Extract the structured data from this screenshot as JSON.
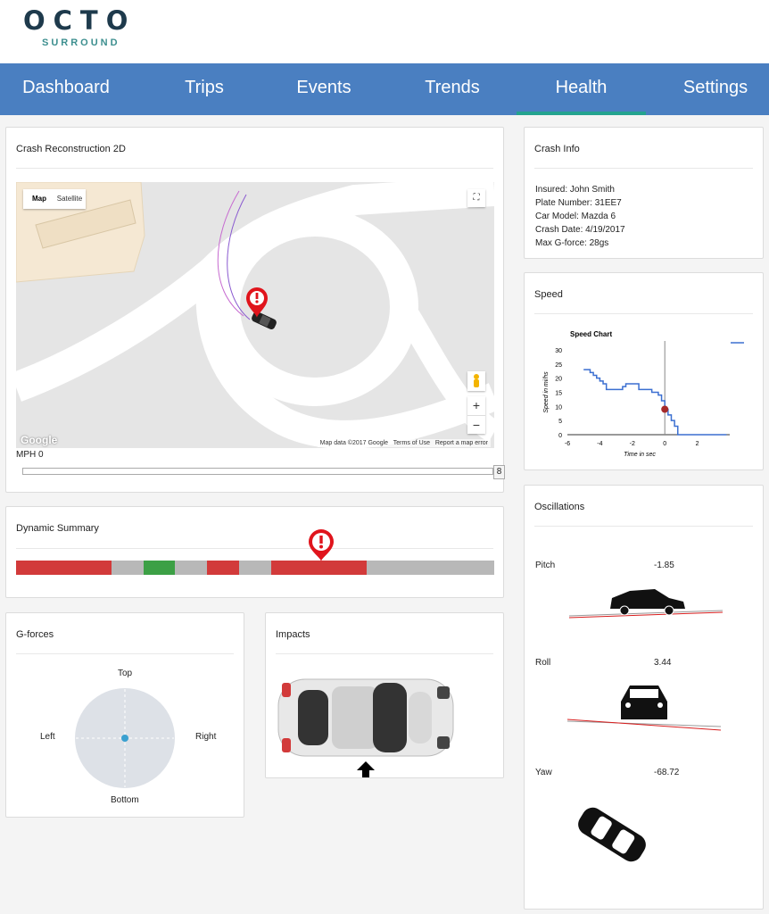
{
  "brand": {
    "name": "OCTO",
    "sub": "SURROUND"
  },
  "nav": {
    "items": [
      {
        "label": "Dashboard",
        "active": false
      },
      {
        "label": "Trips",
        "active": false
      },
      {
        "label": "Events",
        "active": false
      },
      {
        "label": "Trends",
        "active": false
      },
      {
        "label": "Health",
        "active": true
      },
      {
        "label": "Settings",
        "active": false
      }
    ]
  },
  "crash_reconstruction": {
    "title": "Crash Reconstruction 2D",
    "map_tab": "Map",
    "satellite_tab": "Satellite",
    "attribution": {
      "data": "Map data ©2017 Google",
      "terms": "Terms of Use",
      "report": "Report a map error"
    },
    "google_label": "Google",
    "zoom_in": "+",
    "zoom_out": "−",
    "speed_label": "MPH 0",
    "slider_max": "8"
  },
  "dynamic_summary": {
    "title": "Dynamic Summary"
  },
  "gforces": {
    "title": "G-forces",
    "top": "Top",
    "left": "Left",
    "right": "Right",
    "bottom": "Bottom"
  },
  "impacts": {
    "title": "Impacts"
  },
  "crash_info": {
    "title": "Crash Info",
    "lines": [
      "Insured: John Smith",
      "Plate Number: 31EE7",
      "Car Model: Mazda 6",
      "Crash Date: 4/19/2017",
      "Max G-force: 28gs"
    ]
  },
  "speed": {
    "title": "Speed",
    "chart_data": {
      "type": "line",
      "title": "Speed Chart",
      "xlabel": "Time in sec",
      "ylabel": "Speed in mi/hs",
      "xlim": [
        -6,
        4
      ],
      "ylim": [
        0,
        30
      ],
      "xticks": [
        -6,
        -4,
        -2,
        0,
        2
      ],
      "yticks": [
        0,
        5,
        10,
        15,
        20,
        25,
        30
      ],
      "color": "#3b6fd1",
      "marker_color": "#a52a2a",
      "series": [
        {
          "x": [
            -5,
            -4.6,
            -4.4,
            -4.2,
            -4.0,
            -3.8,
            -3.6,
            -2.8,
            -2.6,
            -2.4,
            -2.0,
            -1.6,
            -1.0,
            -0.8,
            -0.4,
            -0.2,
            0,
            0.2,
            0.4,
            0.6,
            0.8,
            3.8
          ],
          "y": [
            23,
            22,
            21,
            20,
            19,
            18,
            16,
            16,
            17,
            18,
            18,
            16,
            16,
            15,
            14,
            12,
            9,
            7,
            5,
            3,
            0,
            0
          ]
        }
      ],
      "marker": {
        "x": 0,
        "y": 9
      },
      "vline_x": 0
    }
  },
  "oscillations": {
    "title": "Oscillations",
    "pitch": {
      "label": "Pitch",
      "value": "-1.85"
    },
    "roll": {
      "label": "Roll",
      "value": "3.44"
    },
    "yaw": {
      "label": "Yaw",
      "value": "-68.72"
    }
  },
  "summary_segments": [
    {
      "color": "#d23a3a",
      "fraction": 0.2
    },
    {
      "color": "#b8b8b8",
      "fraction": 0.066
    },
    {
      "color": "#3ca045",
      "fraction": 0.067
    },
    {
      "color": "#b8b8b8",
      "fraction": 0.067
    },
    {
      "color": "#d23a3a",
      "fraction": 0.067
    },
    {
      "color": "#b8b8b8",
      "fraction": 0.066
    },
    {
      "color": "#d23a3a",
      "fraction": 0.2
    },
    {
      "color": "#b8b8b8",
      "fraction": 0.267
    }
  ],
  "colors": {
    "nav": "#4a7fc1",
    "active_underline": "#24a38f",
    "alert": "#e0141c"
  }
}
